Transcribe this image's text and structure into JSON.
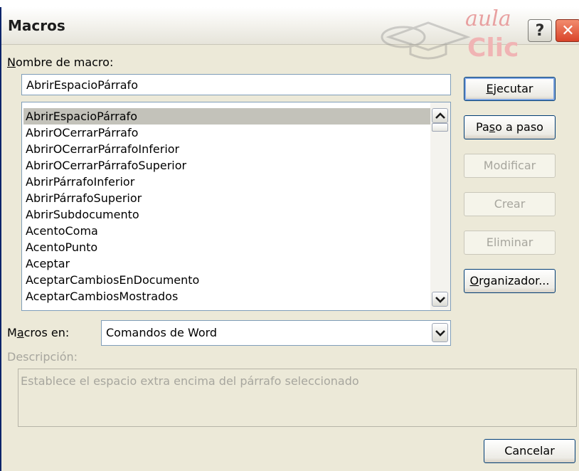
{
  "window": {
    "title": "Macros",
    "help_label": "?",
    "close_label": "✕",
    "watermark": {
      "line1": "aula",
      "line2": "Clic"
    }
  },
  "macro_name": {
    "label_prefix": "N",
    "label_rest": "ombre de macro:",
    "value": "AbrirEspacioPárrafo"
  },
  "macro_list": {
    "items": [
      "AbrirEspacioPárrafo",
      "AbrirOCerrarPárrafo",
      "AbrirOCerrarPárrafoInferior",
      "AbrirOCerrarPárrafoSuperior",
      "AbrirPárrafoInferior",
      "AbrirPárrafoSuperior",
      "AbrirSubdocumento",
      "AcentoComa",
      "AcentoPunto",
      "Aceptar",
      "AceptarCambiosEnDocumento",
      "AceptarCambiosMostrados"
    ],
    "selected_index": 0
  },
  "macros_en": {
    "label_pre": "M",
    "label_ul": "a",
    "label_post": "cros en:",
    "value": "Comandos de Word"
  },
  "description": {
    "label": "Descripción:",
    "text": "Establece el espacio extra encima del párrafo seleccionado"
  },
  "buttons": {
    "run": {
      "ul": "E",
      "rest": "jecutar"
    },
    "step": {
      "pre": "Pa",
      "ul": "s",
      "post": "o a paso"
    },
    "edit": "Modificar",
    "create": "Crear",
    "delete": "Eliminar",
    "organizer": {
      "ul": "O",
      "rest": "rganizador..."
    },
    "cancel": "Cancelar"
  },
  "colors": {
    "dialog_bg": "#ece9d8",
    "selection": "#c3c2ba",
    "button_border": "#003c74",
    "disabled_text": "#a7a69e",
    "close_red": "#d9442a"
  }
}
